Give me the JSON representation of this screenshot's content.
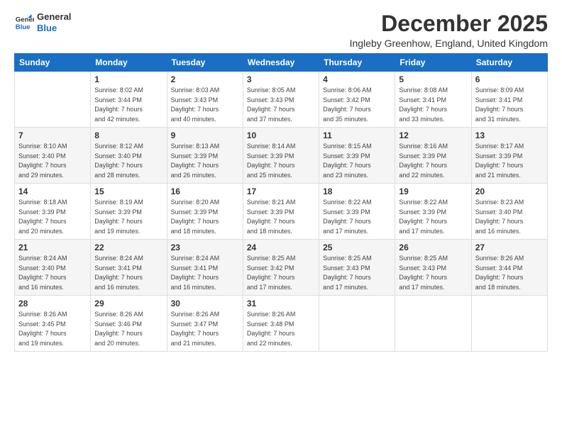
{
  "logo": {
    "line1": "General",
    "line2": "Blue"
  },
  "title": "December 2025",
  "subtitle": "Ingleby Greenhow, England, United Kingdom",
  "weekdays": [
    "Sunday",
    "Monday",
    "Tuesday",
    "Wednesday",
    "Thursday",
    "Friday",
    "Saturday"
  ],
  "weeks": [
    [
      {
        "day": "",
        "info": ""
      },
      {
        "day": "1",
        "info": "Sunrise: 8:02 AM\nSunset: 3:44 PM\nDaylight: 7 hours\nand 42 minutes."
      },
      {
        "day": "2",
        "info": "Sunrise: 8:03 AM\nSunset: 3:43 PM\nDaylight: 7 hours\nand 40 minutes."
      },
      {
        "day": "3",
        "info": "Sunrise: 8:05 AM\nSunset: 3:43 PM\nDaylight: 7 hours\nand 37 minutes."
      },
      {
        "day": "4",
        "info": "Sunrise: 8:06 AM\nSunset: 3:42 PM\nDaylight: 7 hours\nand 35 minutes."
      },
      {
        "day": "5",
        "info": "Sunrise: 8:08 AM\nSunset: 3:41 PM\nDaylight: 7 hours\nand 33 minutes."
      },
      {
        "day": "6",
        "info": "Sunrise: 8:09 AM\nSunset: 3:41 PM\nDaylight: 7 hours\nand 31 minutes."
      }
    ],
    [
      {
        "day": "7",
        "info": "Sunrise: 8:10 AM\nSunset: 3:40 PM\nDaylight: 7 hours\nand 29 minutes."
      },
      {
        "day": "8",
        "info": "Sunrise: 8:12 AM\nSunset: 3:40 PM\nDaylight: 7 hours\nand 28 minutes."
      },
      {
        "day": "9",
        "info": "Sunrise: 8:13 AM\nSunset: 3:39 PM\nDaylight: 7 hours\nand 26 minutes."
      },
      {
        "day": "10",
        "info": "Sunrise: 8:14 AM\nSunset: 3:39 PM\nDaylight: 7 hours\nand 25 minutes."
      },
      {
        "day": "11",
        "info": "Sunrise: 8:15 AM\nSunset: 3:39 PM\nDaylight: 7 hours\nand 23 minutes."
      },
      {
        "day": "12",
        "info": "Sunrise: 8:16 AM\nSunset: 3:39 PM\nDaylight: 7 hours\nand 22 minutes."
      },
      {
        "day": "13",
        "info": "Sunrise: 8:17 AM\nSunset: 3:39 PM\nDaylight: 7 hours\nand 21 minutes."
      }
    ],
    [
      {
        "day": "14",
        "info": "Sunrise: 8:18 AM\nSunset: 3:39 PM\nDaylight: 7 hours\nand 20 minutes."
      },
      {
        "day": "15",
        "info": "Sunrise: 8:19 AM\nSunset: 3:39 PM\nDaylight: 7 hours\nand 19 minutes."
      },
      {
        "day": "16",
        "info": "Sunrise: 8:20 AM\nSunset: 3:39 PM\nDaylight: 7 hours\nand 18 minutes."
      },
      {
        "day": "17",
        "info": "Sunrise: 8:21 AM\nSunset: 3:39 PM\nDaylight: 7 hours\nand 18 minutes."
      },
      {
        "day": "18",
        "info": "Sunrise: 8:22 AM\nSunset: 3:39 PM\nDaylight: 7 hours\nand 17 minutes."
      },
      {
        "day": "19",
        "info": "Sunrise: 8:22 AM\nSunset: 3:39 PM\nDaylight: 7 hours\nand 17 minutes."
      },
      {
        "day": "20",
        "info": "Sunrise: 8:23 AM\nSunset: 3:40 PM\nDaylight: 7 hours\nand 16 minutes."
      }
    ],
    [
      {
        "day": "21",
        "info": "Sunrise: 8:24 AM\nSunset: 3:40 PM\nDaylight: 7 hours\nand 16 minutes."
      },
      {
        "day": "22",
        "info": "Sunrise: 8:24 AM\nSunset: 3:41 PM\nDaylight: 7 hours\nand 16 minutes."
      },
      {
        "day": "23",
        "info": "Sunrise: 8:24 AM\nSunset: 3:41 PM\nDaylight: 7 hours\nand 16 minutes."
      },
      {
        "day": "24",
        "info": "Sunrise: 8:25 AM\nSunset: 3:42 PM\nDaylight: 7 hours\nand 17 minutes."
      },
      {
        "day": "25",
        "info": "Sunrise: 8:25 AM\nSunset: 3:43 PM\nDaylight: 7 hours\nand 17 minutes."
      },
      {
        "day": "26",
        "info": "Sunrise: 8:25 AM\nSunset: 3:43 PM\nDaylight: 7 hours\nand 17 minutes."
      },
      {
        "day": "27",
        "info": "Sunrise: 8:26 AM\nSunset: 3:44 PM\nDaylight: 7 hours\nand 18 minutes."
      }
    ],
    [
      {
        "day": "28",
        "info": "Sunrise: 8:26 AM\nSunset: 3:45 PM\nDaylight: 7 hours\nand 19 minutes."
      },
      {
        "day": "29",
        "info": "Sunrise: 8:26 AM\nSunset: 3:46 PM\nDaylight: 7 hours\nand 20 minutes."
      },
      {
        "day": "30",
        "info": "Sunrise: 8:26 AM\nSunset: 3:47 PM\nDaylight: 7 hours\nand 21 minutes."
      },
      {
        "day": "31",
        "info": "Sunrise: 8:26 AM\nSunset: 3:48 PM\nDaylight: 7 hours\nand 22 minutes."
      },
      {
        "day": "",
        "info": ""
      },
      {
        "day": "",
        "info": ""
      },
      {
        "day": "",
        "info": ""
      }
    ]
  ]
}
